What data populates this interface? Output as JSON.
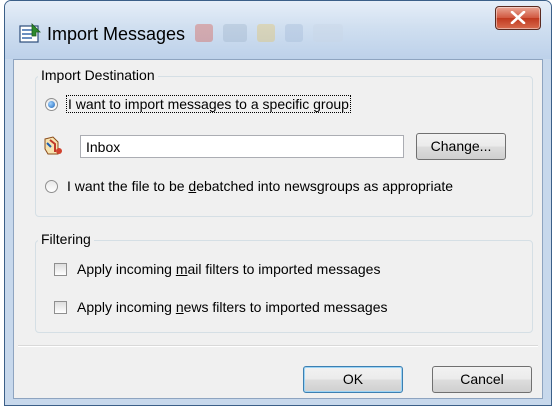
{
  "window": {
    "title": "Import Messages"
  },
  "import_destination": {
    "group_title": "Import Destination",
    "option_specific": {
      "pre": "I want to import messages to a specific ",
      "accel": "g",
      "post": "roup",
      "selected": true
    },
    "group_field_value": "Inbox",
    "change_label": "Change...",
    "option_debatch": {
      "pre": "I want the file to be ",
      "accel": "d",
      "post": "ebatched into newsgroups as appropriate",
      "selected": false
    }
  },
  "filtering": {
    "group_title": "Filtering",
    "mail_filters": {
      "pre": "Apply incoming ",
      "accel": "m",
      "post": "ail filters to imported messages",
      "checked": false
    },
    "news_filters": {
      "pre": "Apply incoming ",
      "accel": "n",
      "post": "ews filters to imported messages",
      "checked": false
    }
  },
  "buttons": {
    "ok": "OK",
    "cancel": "Cancel"
  },
  "icons": {
    "title_icon": "import-folder-icon",
    "group_icon": "newsgroup-icon",
    "close_icon": "close-icon"
  },
  "colors": {
    "title_bar": "#c7d8ec",
    "close_button": "#c7452b",
    "dialog_bg": "#f0f0f0"
  }
}
